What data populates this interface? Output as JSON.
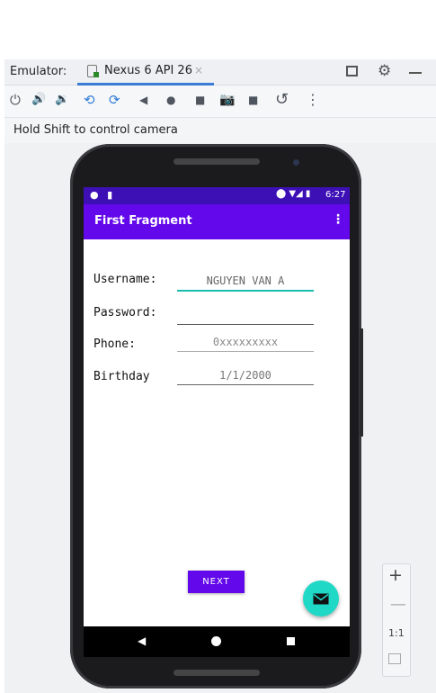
{
  "emulator": {
    "label": "Emulator:",
    "tab_title": "Nexus 6 API 26",
    "tab_close": "×",
    "hint": "Hold Shift to control camera",
    "toolbar": [
      {
        "name": "power-icon",
        "glyph": "⏻"
      },
      {
        "name": "volume-up-icon",
        "glyph": "🔊"
      },
      {
        "name": "volume-down-icon",
        "glyph": "🔉"
      },
      {
        "name": "rotate-left-icon",
        "glyph": "⟲"
      },
      {
        "name": "rotate-right-icon",
        "glyph": "⟳"
      },
      {
        "name": "back-icon",
        "glyph": "◀"
      },
      {
        "name": "home-icon",
        "glyph": "●"
      },
      {
        "name": "overview-icon",
        "glyph": "■"
      },
      {
        "name": "camera-icon",
        "glyph": "📷"
      },
      {
        "name": "screen-record-icon",
        "glyph": "■"
      },
      {
        "name": "snapshot-icon",
        "glyph": "↺"
      },
      {
        "name": "more-icon",
        "glyph": "⋮"
      }
    ],
    "settings_glyph": "⚙"
  },
  "phone": {
    "status": {
      "left": "● ▮",
      "icons": "⬤ ▼◢ ▮",
      "time": "6:27"
    },
    "app_bar": {
      "title": "First Fragment",
      "overflow": "⋮"
    },
    "form": {
      "username_label": "Username:",
      "username_value": "NGUYEN VAN A",
      "password_label": "Password:",
      "password_value": "",
      "phone_label": "Phone:",
      "phone_placeholder": "0xxxxxxxxx",
      "birthday_label": "Birthday",
      "birthday_placeholder": "1/1/2000"
    },
    "next_label": "NEXT",
    "nav": {
      "back": "◀"
    }
  },
  "zoom": {
    "in": "+",
    "out": "—",
    "actual": "1:1"
  },
  "colors": {
    "primary": "#6308ea",
    "status_bar": "#3d10b6",
    "accent": "#1fd8c6"
  }
}
